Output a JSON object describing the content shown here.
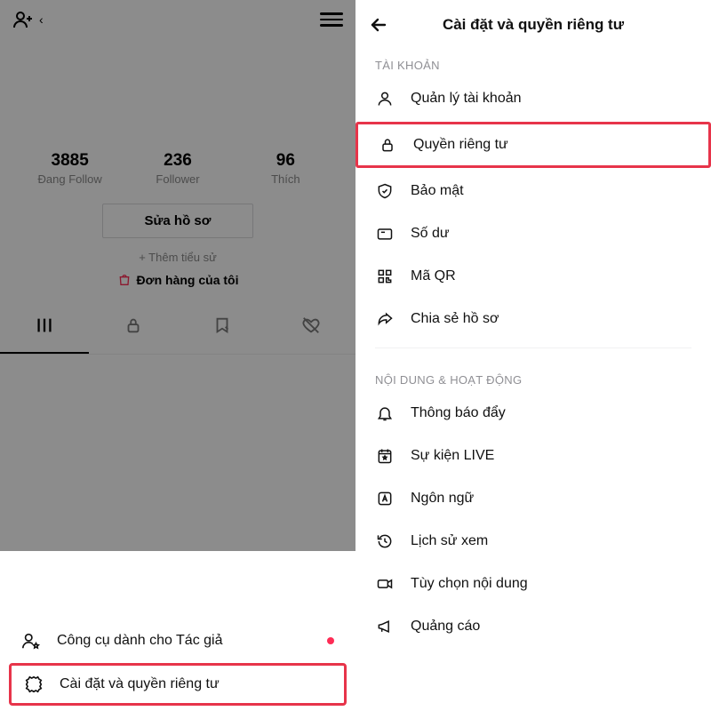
{
  "left": {
    "stats": {
      "following_count": "3885",
      "following_label": "Đang Follow",
      "follower_count": "236",
      "follower_label": "Follower",
      "like_count": "96",
      "like_label": "Thích"
    },
    "edit_profile": "Sửa hồ sơ",
    "add_bio": "+ Thêm tiểu sử",
    "my_orders": "Đơn hàng của tôi",
    "sheet": {
      "creator_tools": "Công cụ dành cho Tác giả",
      "settings_privacy": "Cài đặt và quyền riêng tư"
    }
  },
  "right": {
    "header_title": "Cài đặt và quyền riêng tư",
    "section_account": "TÀI KHOẢN",
    "section_content": "NỘI DUNG & HOẠT ĐỘNG",
    "items": {
      "manage_account": "Quản lý tài khoản",
      "privacy": "Quyền riêng tư",
      "security": "Bảo mật",
      "balance": "Số dư",
      "qr_code": "Mã QR",
      "share_profile": "Chia sẻ hồ sơ",
      "push_notifications": "Thông báo đẩy",
      "live_events": "Sự kiện LIVE",
      "language": "Ngôn ngữ",
      "watch_history": "Lịch sử xem",
      "content_prefs": "Tùy chọn nội dung",
      "ads": "Quảng cáo"
    }
  }
}
